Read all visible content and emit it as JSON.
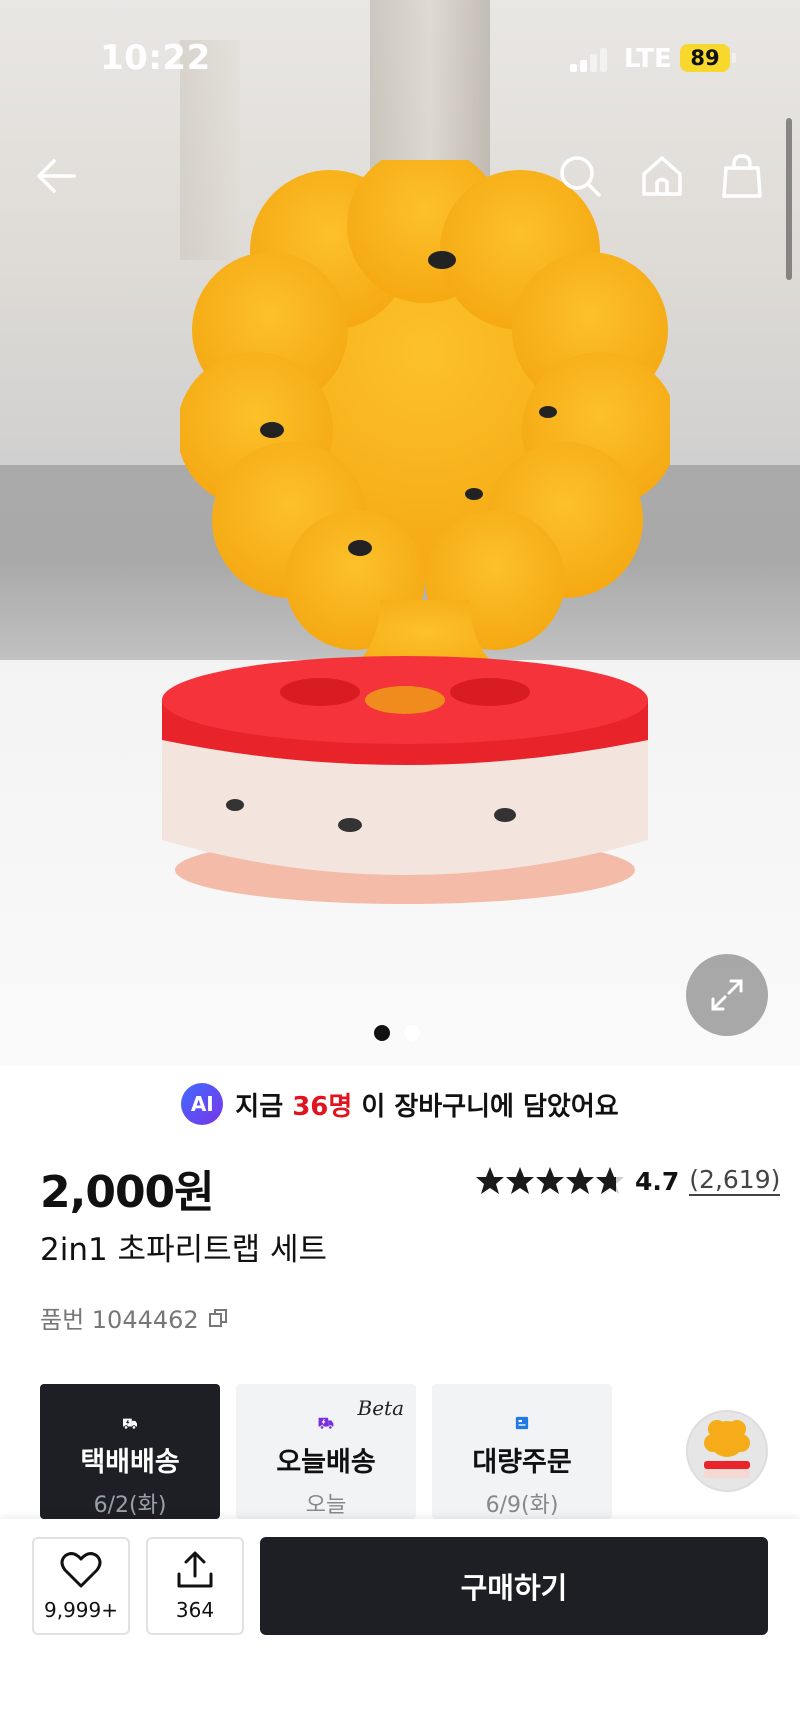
{
  "status_bar": {
    "time": "10:22",
    "network": "LTE",
    "battery": "89"
  },
  "nav": {
    "back_icon": "arrow-left-icon",
    "search_icon": "search-icon",
    "home_icon": "home-icon",
    "cart_icon": "shopping-bag-icon"
  },
  "gallery": {
    "image_count": 2,
    "active_index": 0,
    "expand_icon": "expand-icon"
  },
  "ai_banner": {
    "badge": "AI",
    "prefix": "지금",
    "count": "36명",
    "suffix": "이 장바구니에 담았어요"
  },
  "product": {
    "price": "2,000원",
    "rating": 4.7,
    "rating_text": "4.7",
    "review_count": "(2,619)",
    "title": "2in1 초파리트랩 세트",
    "sku_label": "품번 1044462",
    "copy_icon": "copy-icon"
  },
  "delivery_options": [
    {
      "title": "택배배송",
      "sub": "6/2(화)",
      "icon": "delivery-truck-icon",
      "selected": true
    },
    {
      "title": "오늘배송",
      "sub": "오늘",
      "icon": "quick-delivery-icon",
      "badge": "Beta",
      "selected": false
    },
    {
      "title": "대량주문",
      "sub": "6/9(화)",
      "icon": "bulk-order-icon",
      "selected": false
    }
  ],
  "bottom_bar": {
    "like_count": "9,999+",
    "share_count": "364",
    "buy_label": "구매하기"
  },
  "colors": {
    "accent_red": "#e0141e",
    "dark": "#1d1f25",
    "flower_yellow": "#f7b51e",
    "base_red": "#e8242a"
  }
}
